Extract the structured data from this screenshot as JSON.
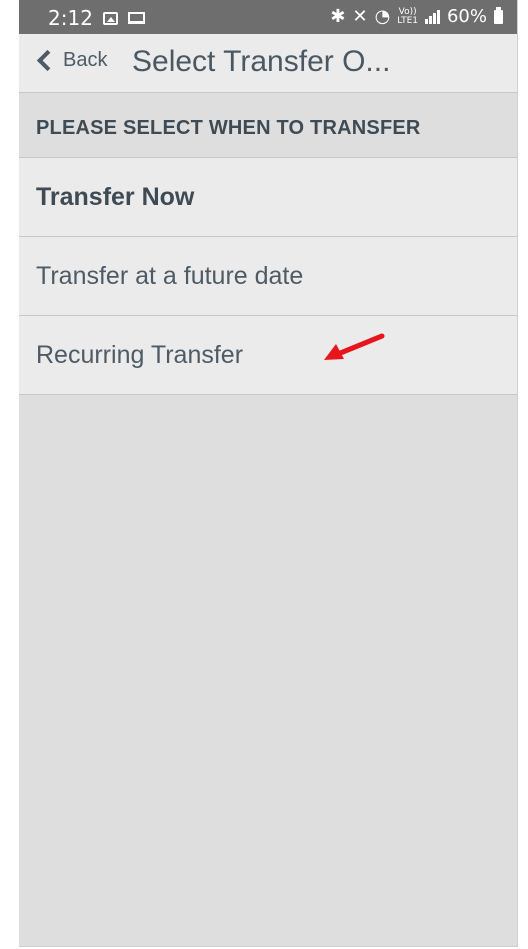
{
  "status_bar": {
    "time": "2:12",
    "battery": "60%",
    "volte_top": "Vo))",
    "volte_bottom": "LTE1"
  },
  "nav": {
    "back_label": "Back",
    "title": "Select Transfer O..."
  },
  "section": {
    "header": "PLEASE SELECT WHEN TO TRANSFER"
  },
  "options": [
    {
      "label": "Transfer Now"
    },
    {
      "label": "Transfer at a future date"
    },
    {
      "label": "Recurring Transfer"
    }
  ],
  "colors": {
    "status_bar": "#6e6e6e",
    "surface": "#ebebeb",
    "background": "#dedede",
    "text": "#4f5b64",
    "annotation": "#e8161c"
  },
  "icons": [
    "image-icon",
    "laptop-icon",
    "bluetooth-icon",
    "mute-icon",
    "wifi-icon",
    "volte-icon",
    "signal-icon",
    "battery-icon",
    "chevron-left-icon",
    "arrow-annotation-icon"
  ]
}
